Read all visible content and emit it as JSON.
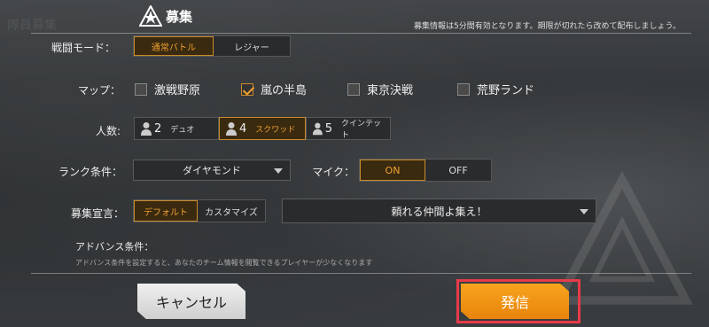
{
  "header": {
    "title": "募集",
    "notice": "募集情報は5分間有効となります。期限が切れたら改めて配布しましょう。",
    "background_tab": "隊員募集"
  },
  "battle_mode": {
    "label": "戦闘モード：",
    "options": [
      "通常バトル",
      "レジャー"
    ],
    "selected": "通常バトル"
  },
  "map": {
    "label": "マップ：",
    "options": [
      {
        "name": "激戦野原",
        "checked": false
      },
      {
        "name": "嵐の半島",
        "checked": true
      },
      {
        "name": "東京決戦",
        "checked": false
      },
      {
        "name": "荒野ランド",
        "checked": false
      }
    ]
  },
  "players": {
    "label": "人数:",
    "options": [
      {
        "num": "2",
        "name": "デュオ"
      },
      {
        "num": "4",
        "name": "スクワッド"
      },
      {
        "num": "5",
        "name": "クインテット"
      }
    ],
    "selected": "スクワッド"
  },
  "rank": {
    "label": "ランク条件：",
    "value": "ダイヤモンド"
  },
  "mic": {
    "label": "マイク：",
    "options": [
      "ON",
      "OFF"
    ],
    "selected": "ON"
  },
  "declaration": {
    "label": "募集宣言：",
    "options": [
      "デフォルト",
      "カスタマイズ"
    ],
    "selected": "デフォルト",
    "message": "頼れる仲間よ集え！"
  },
  "advanced": {
    "title": "アドバンス条件：",
    "description": "アドバンス条件を設定すると、あなたのチーム情報を閲覧できるプレイヤーが少なくなります"
  },
  "buttons": {
    "cancel": "キャンセル",
    "send": "発信"
  },
  "colors": {
    "accent": "#f0a030",
    "send_button": "#f8a41e",
    "highlight_frame": "#e83a4a"
  }
}
